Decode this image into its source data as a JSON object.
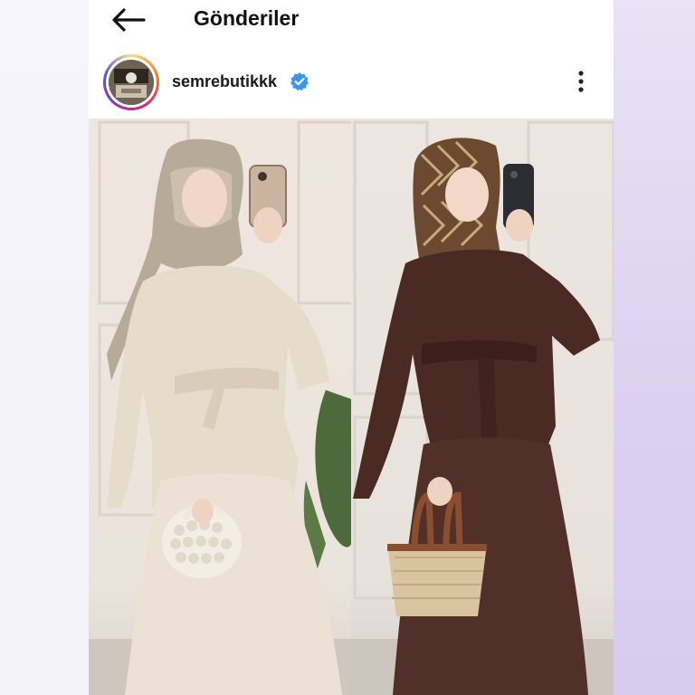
{
  "header": {
    "back_icon": "arrow-left-icon",
    "title": "Gönderiler"
  },
  "post": {
    "username": "semrebutikkk",
    "verified": true,
    "verified_icon": "verified-badge-icon",
    "more_icon": "more-vertical-icon",
    "image_description_hidden": ""
  },
  "colors": {
    "text_primary": "#111111",
    "verified_blue": "#3897f0",
    "beige_outfit": "#e9dfcf",
    "brown_outfit": "#4a2a22"
  }
}
